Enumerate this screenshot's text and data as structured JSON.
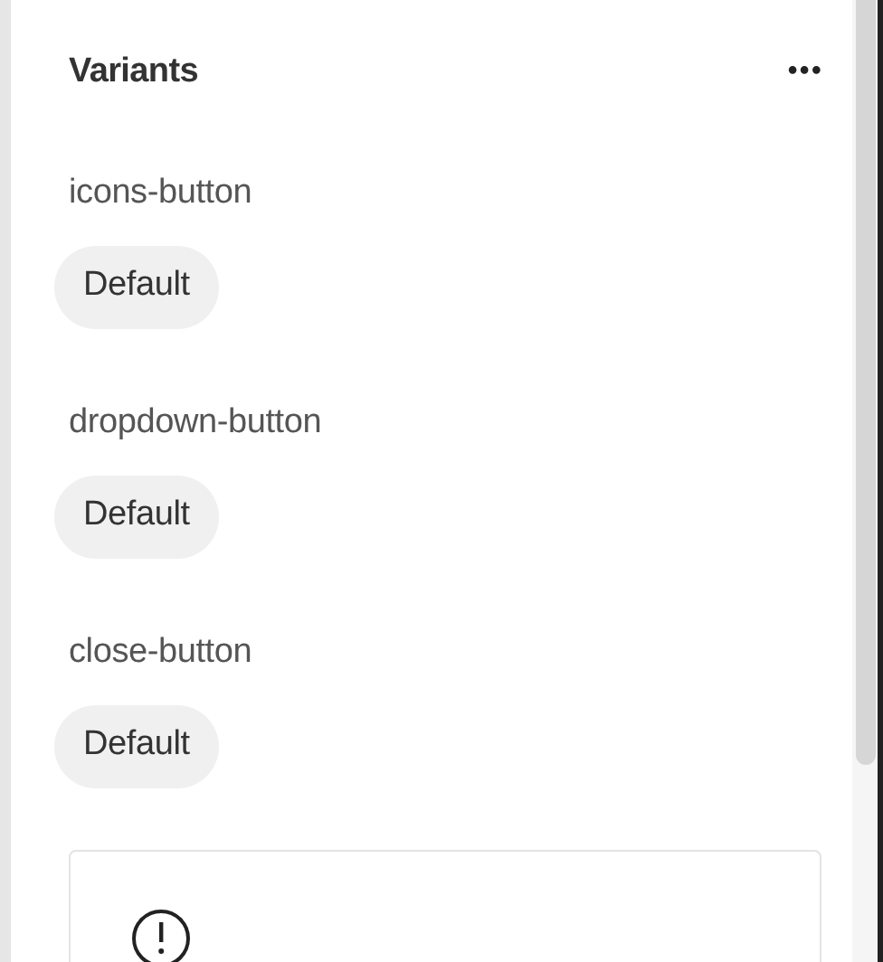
{
  "panel": {
    "title": "Variants",
    "more": "•••"
  },
  "components": [
    {
      "name": "icons-button",
      "variant": "Default"
    },
    {
      "name": "dropdown-button",
      "variant": "Default"
    },
    {
      "name": "close-button",
      "variant": "Default"
    }
  ]
}
